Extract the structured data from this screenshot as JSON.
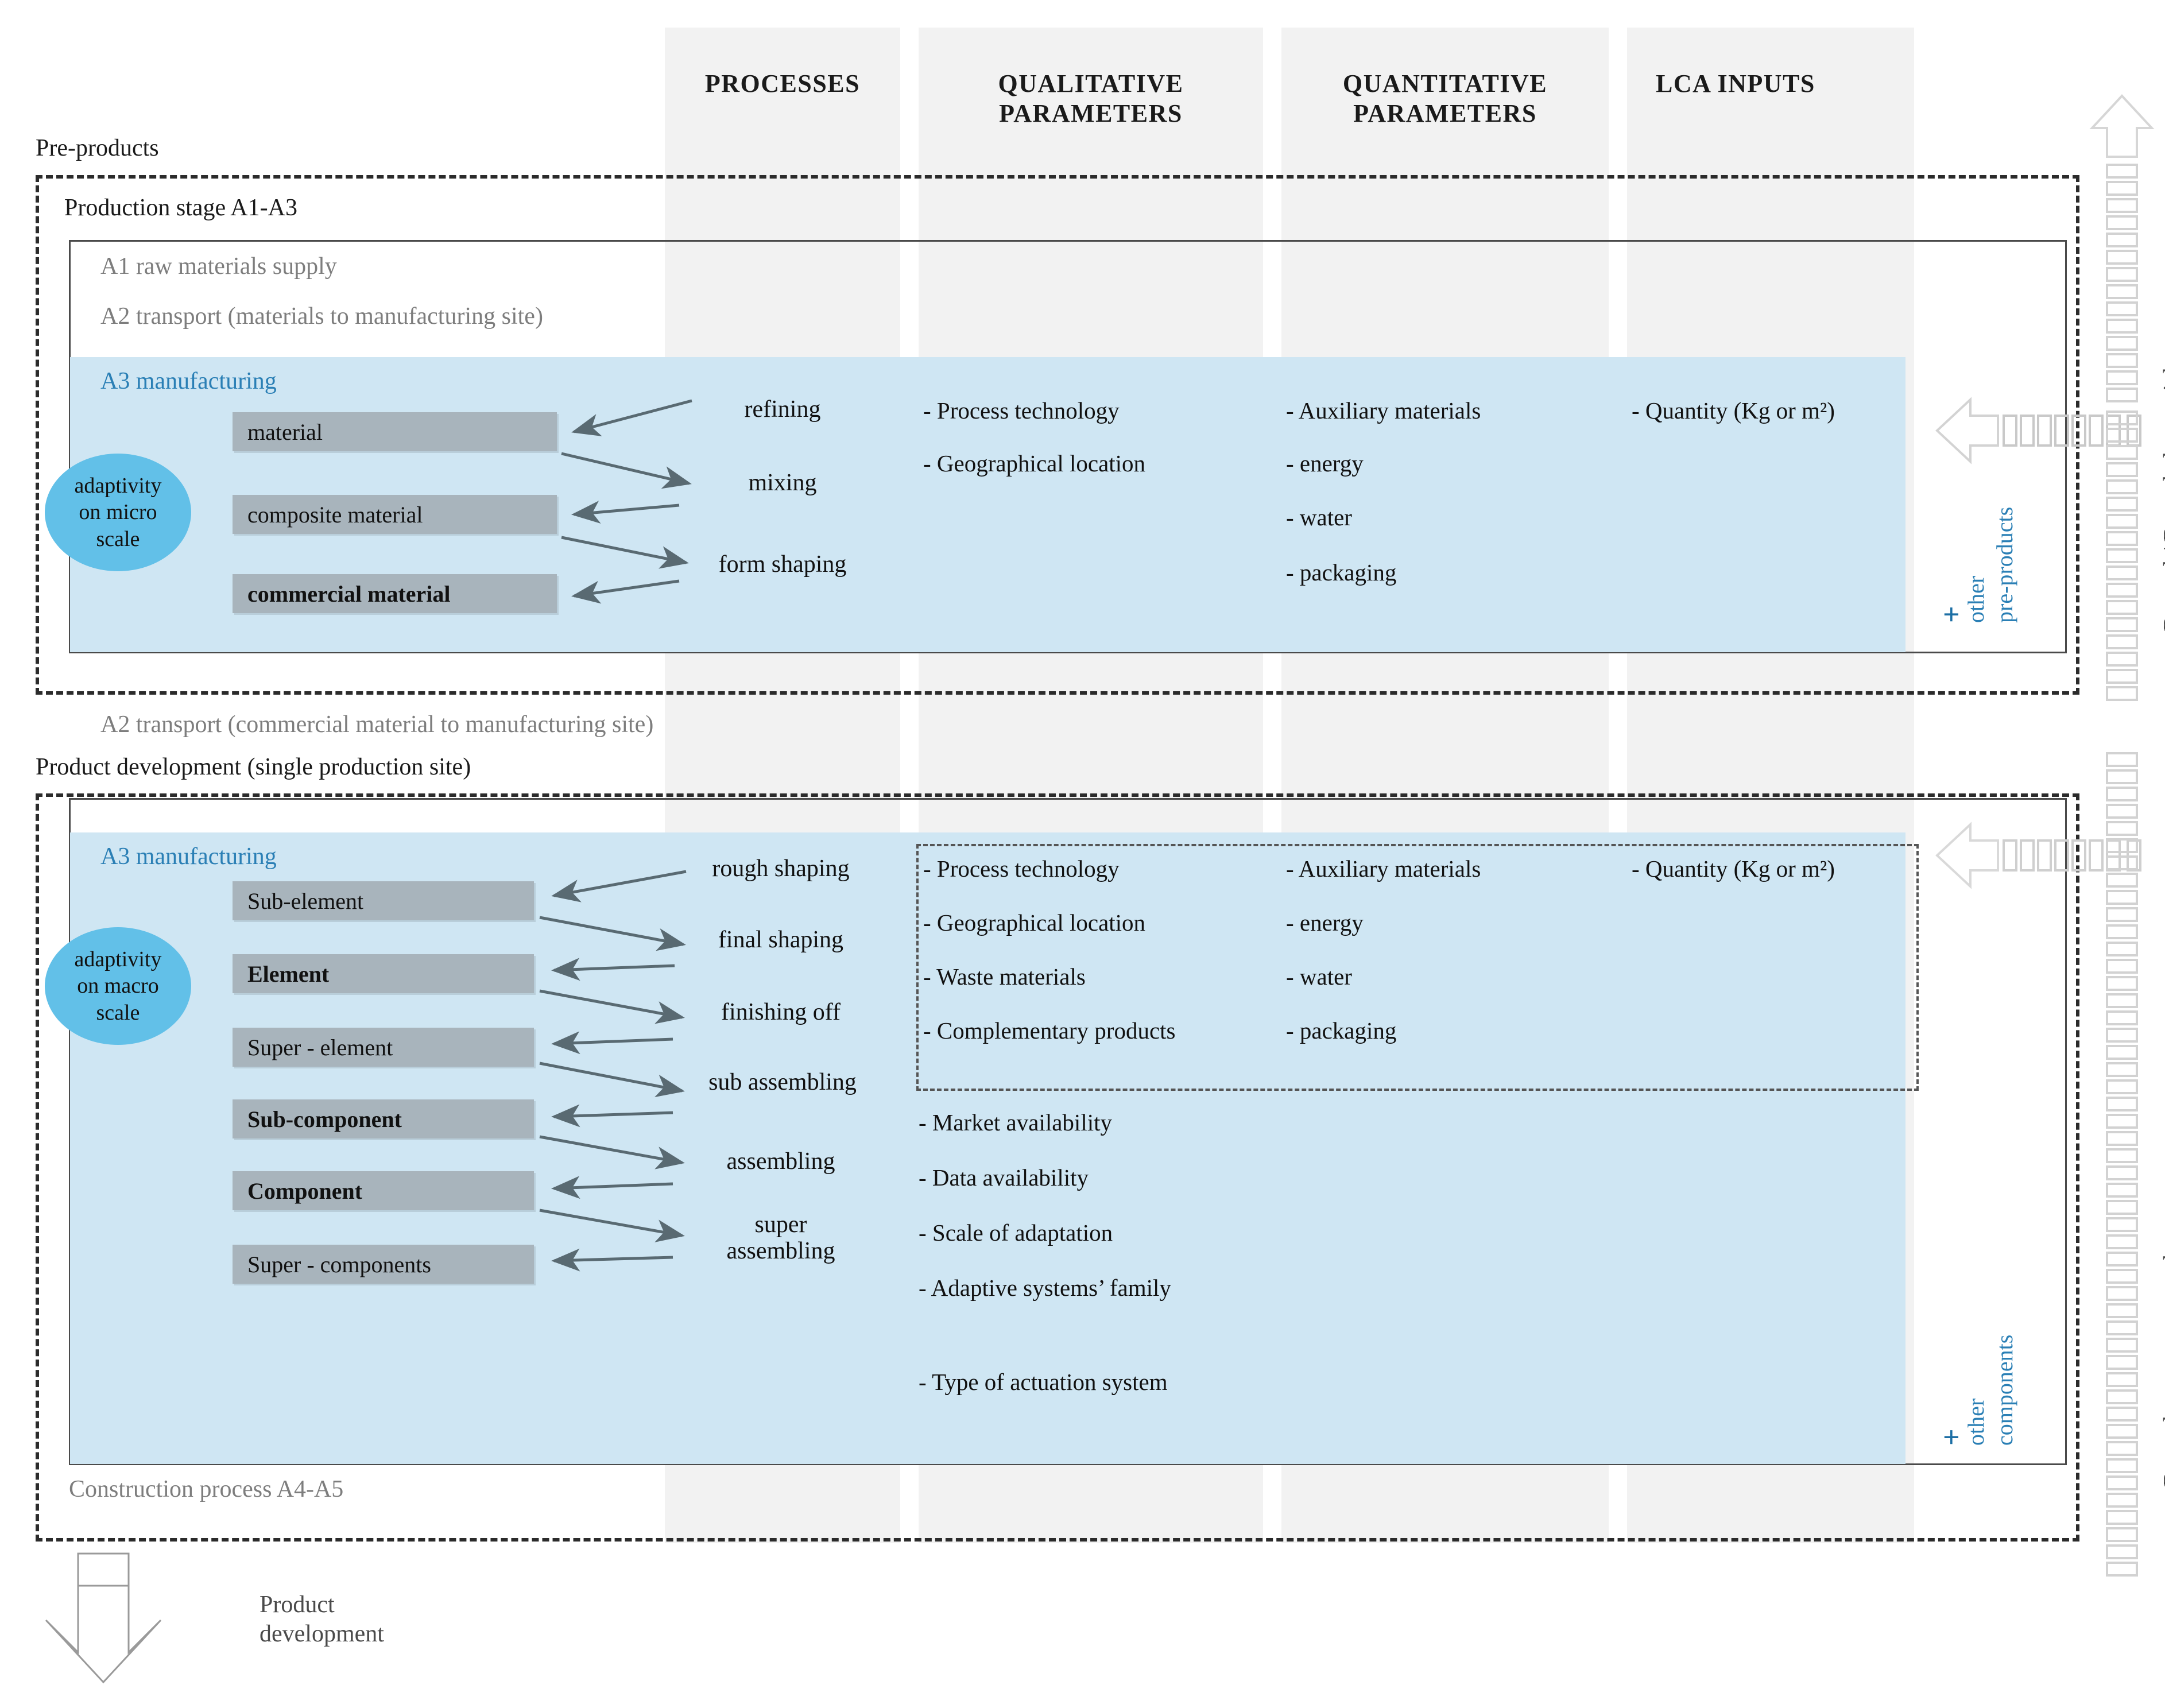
{
  "columns": {
    "headers": [
      {
        "label": "PROCESSES"
      },
      {
        "label": "QUALITATIVE\nPARAMETERS",
        "line1": "QUALITATIVE",
        "line2": "PARAMETERS"
      },
      {
        "label": "QUANTITATIVE\nPARAMETERS",
        "line1": "QUANTITATIVE",
        "line2": "PARAMETERS"
      },
      {
        "label": "LCA INPUTS"
      }
    ]
  },
  "top_section": {
    "outer_label": "Pre-products",
    "stage_label": "Production stage A1-A3",
    "a1": "A1 raw materials supply",
    "a2": "A2 transport (materials to manufacturing site)",
    "a3": "A3 manufacturing",
    "adaptivity": {
      "line1": "adaptivity",
      "line2": "on micro",
      "line3": "scale"
    },
    "boxes": [
      {
        "label": "material",
        "bold": false
      },
      {
        "label": "composite material",
        "bold": false
      },
      {
        "label": "commercial material",
        "bold": true
      }
    ],
    "processes": [
      "refining",
      "mixing",
      "form shaping"
    ],
    "qualitative": [
      "- Process technology",
      "- Geographical location"
    ],
    "quantitative": [
      "- Auxiliary materials",
      "- energy",
      "- water",
      "- packaging"
    ],
    "lca_inputs": [
      "- Quantity (Kg or m²)"
    ],
    "other_plus": "+",
    "other_line1": "other",
    "other_line2": "pre-products"
  },
  "middle_label": "A2 transport (commercial material to manufacturing site)",
  "bottom_section": {
    "outer_label": "Product development (single production site)",
    "a3": "A3 manufacturing",
    "adaptivity": {
      "line1": "adaptivity",
      "line2": "on macro",
      "line3": "scale"
    },
    "boxes": [
      {
        "label": "Sub-element",
        "bold": false
      },
      {
        "label": "Element",
        "bold": true
      },
      {
        "label": "Super - element",
        "bold": false
      },
      {
        "label": "Sub-component",
        "bold": true
      },
      {
        "label": "Component",
        "bold": true
      },
      {
        "label": "Super - components",
        "bold": false
      }
    ],
    "processes": [
      "rough shaping",
      "final shaping",
      "finishing off",
      "sub assembling",
      "assembling",
      "super\nassembling"
    ],
    "process_super_l1": "super",
    "process_super_l2": "assembling",
    "qualitative_boxed": [
      "- Process technology",
      "- Geographical location",
      "- Waste materials",
      "- Complementary products"
    ],
    "qualitative_free": [
      "- Market availability",
      "- Data availability",
      "- Scale of adaptation",
      "- Adaptive systems’ family",
      "- Type of actuation system"
    ],
    "quantitative": [
      "- Auxiliary materials",
      "- energy",
      "- water",
      "- packaging"
    ],
    "lca_inputs": [
      "- Quantity (Kg or m²)"
    ],
    "other_plus": "+",
    "other_line1": "other",
    "other_line2": "components",
    "construction_label": "Construction process A4-A5"
  },
  "right_labels": {
    "top": "Reused / Recycled materials",
    "bottom": "Reused components, sub-systems"
  },
  "legend": {
    "line1": "Product",
    "line2": "development"
  },
  "colors": {
    "blue_band": "#cfe6f3",
    "blue_accent": "#2a7fb5",
    "ellipse": "#62c0e8",
    "gray_box": "#a8b4bc",
    "col_band": "#f2f2f2",
    "gray_text": "#7d7d7d"
  }
}
